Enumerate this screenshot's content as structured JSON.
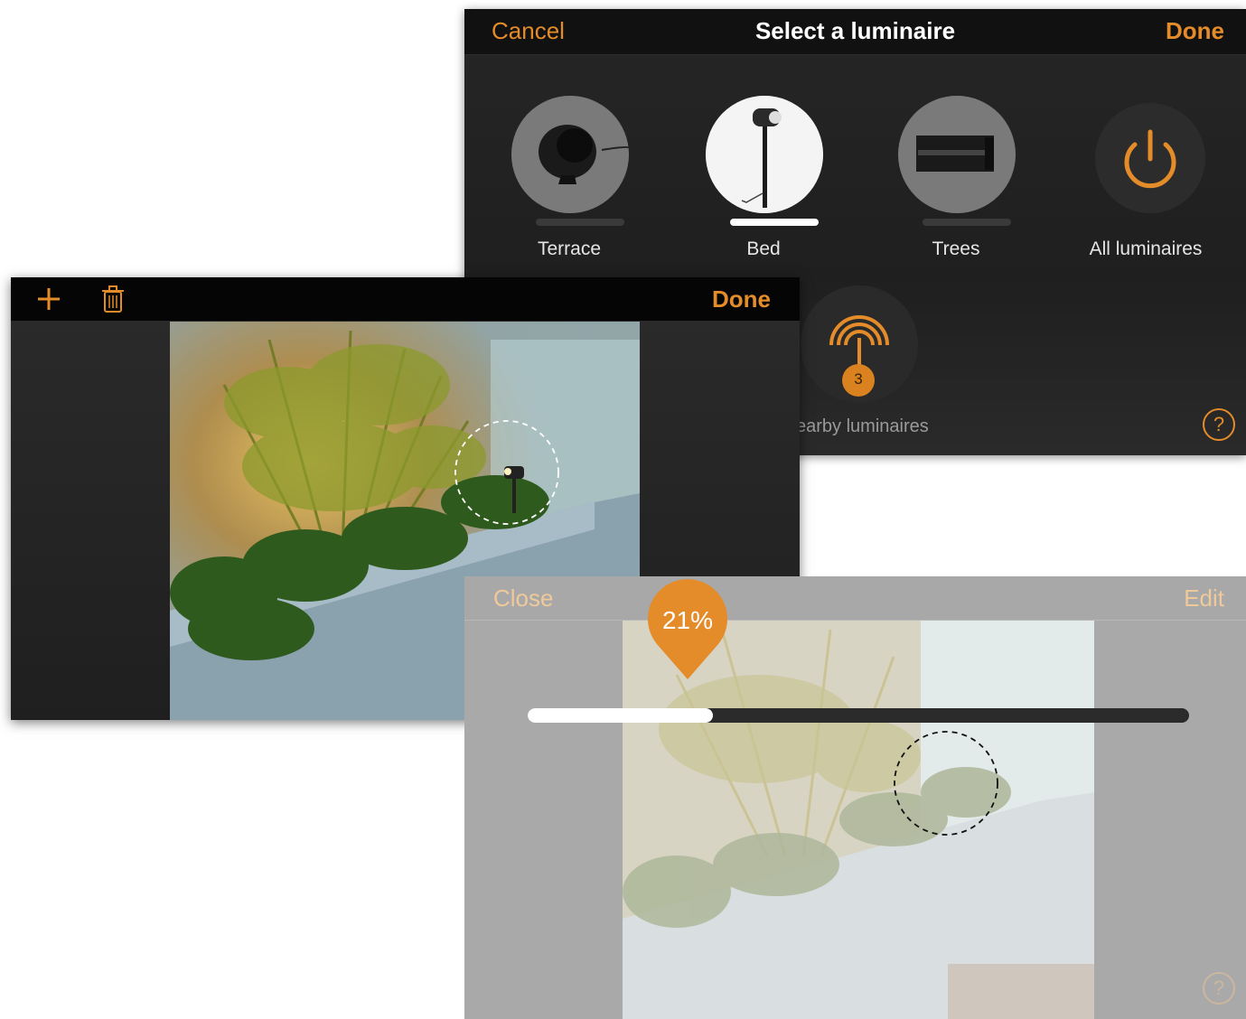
{
  "select_panel": {
    "cancel_label": "Cancel",
    "title": "Select a luminaire",
    "done_label": "Done",
    "luminaires": [
      {
        "label": "Terrace",
        "selected": false
      },
      {
        "label": "Bed",
        "selected": true
      },
      {
        "label": "Trees",
        "selected": false
      },
      {
        "label": "All luminaires",
        "selected": false
      }
    ],
    "nearby": {
      "label": "earby luminaires",
      "count": "3"
    },
    "help_label": "?"
  },
  "edit_panel": {
    "add_icon": "plus-icon",
    "delete_icon": "trash-icon",
    "done_label": "Done"
  },
  "dim_panel": {
    "close_label": "Close",
    "edit_label": "Edit",
    "brightness_text": "21%",
    "brightness_fraction": 0.28,
    "help_label": "?"
  },
  "colors": {
    "accent": "#e48b2a",
    "nav_dark": "#111111",
    "dim_overlay": "#a9a9a9"
  }
}
